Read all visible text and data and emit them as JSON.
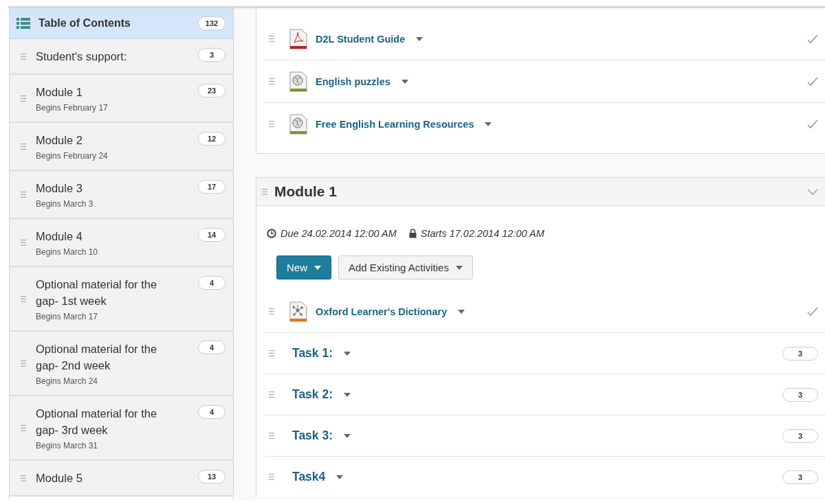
{
  "sidebar": {
    "header": {
      "title": "Table of Contents",
      "count": "132",
      "selected": true
    },
    "items": [
      {
        "title": "Student's support:",
        "count": "3",
        "selected": false
      },
      {
        "title": "Module 1",
        "subtitle": "Begins February 17",
        "count": "23",
        "selected": false
      },
      {
        "title": "Module 2",
        "subtitle": "Begins February 24",
        "count": "12",
        "selected": false
      },
      {
        "title": "Module 3",
        "subtitle": "Begins March 3",
        "count": "17",
        "selected": false
      },
      {
        "title": "Module 4",
        "subtitle": "Begins March 10",
        "count": "14",
        "selected": false
      },
      {
        "title": "Optional material for the gap- 1st week",
        "subtitle": "Begins March 17",
        "count": "4",
        "selected": false
      },
      {
        "title": "Optional material for the gap- 2nd week",
        "subtitle": "Begins March 24",
        "count": "4",
        "selected": false
      },
      {
        "title": "Optional material for the gap- 3rd week",
        "subtitle": "Begins March 31",
        "count": "4",
        "selected": false
      },
      {
        "title": "Module 5",
        "count": "13",
        "selected": false
      }
    ]
  },
  "support_topics": [
    {
      "title": "D2L Student Guide",
      "kind": "pdf"
    },
    {
      "title": "English puzzles",
      "kind": "web"
    },
    {
      "title": "Free English Learning Resources",
      "kind": "web"
    }
  ],
  "module": {
    "title": "Module 1",
    "due": "Due 24.02.2014 12:00 AM",
    "starts": "Starts 17.02.2014 12:00 AM",
    "buttons": [
      {
        "label": "New",
        "kind": "primary"
      },
      {
        "label": "Add Existing Activities",
        "kind": "secondary"
      }
    ],
    "topics": [
      {
        "title": "Oxford Learner's Dictionary",
        "kind": "link"
      }
    ],
    "submodules": [
      {
        "title": "Task 1:",
        "count": "3"
      },
      {
        "title": "Task 2:",
        "count": "3"
      },
      {
        "title": "Task 3:",
        "count": "3"
      },
      {
        "title": "Task4",
        "count": "3"
      }
    ]
  }
}
